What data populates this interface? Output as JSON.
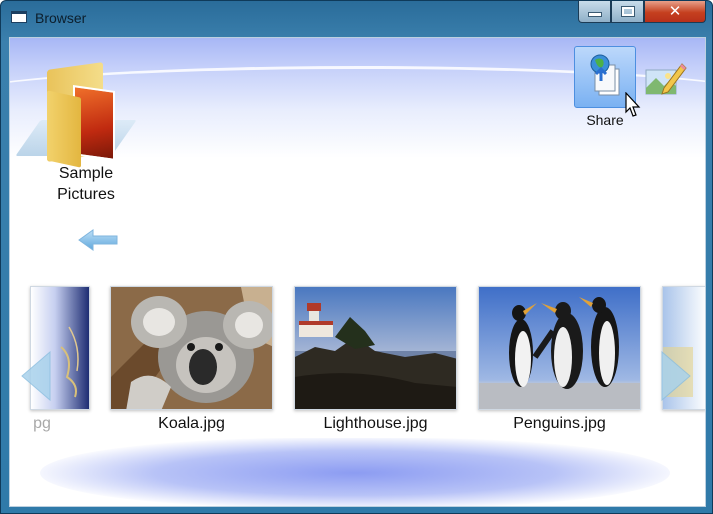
{
  "window": {
    "title": "Browser",
    "close_glyph": "✕"
  },
  "folder": {
    "label_line1": "Sample",
    "label_line2": "Pictures",
    "icon": "folder-icon"
  },
  "toolbar": {
    "share_label": "Share",
    "share_icon": "share-icon",
    "edit_icon": "edit-picture-icon"
  },
  "gallery": {
    "items": [
      {
        "label": "pg",
        "partial": true
      },
      {
        "label": "Koala.jpg"
      },
      {
        "label": "Lighthouse.jpg"
      },
      {
        "label": "Penguins.jpg"
      },
      {
        "label": "",
        "partial": true
      }
    ],
    "prev_icon": "chevron-left-icon",
    "next_icon": "chevron-right-icon"
  },
  "colors": {
    "frame": "#2f7aa9",
    "accent": "#7ab1f2",
    "close": "#c5401f"
  }
}
